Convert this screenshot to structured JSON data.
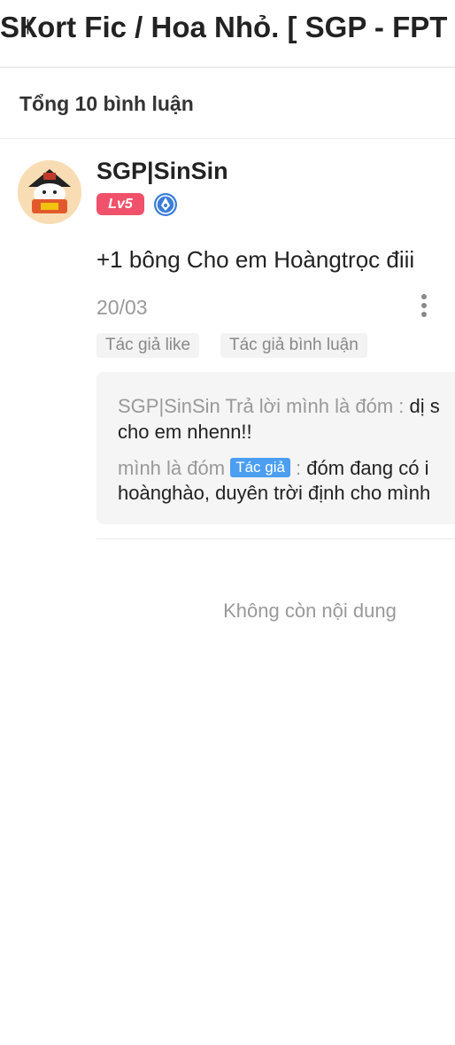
{
  "header": {
    "title": "SҜort Fic / Hoa Nhỏ. [ SGP - FPT"
  },
  "comments_header": {
    "count_label": "Tổng 10 bình luận"
  },
  "comment": {
    "username": "SGP|SinSin",
    "level": "Lv5",
    "text": "+1 bông Cho em Hoàngtrọc điii",
    "date": "20/03",
    "tags": [
      "Tác giả like",
      "Tác giả bình luận"
    ],
    "replies": [
      {
        "author": "SGP|SinSin",
        "connector": " Trả lời ",
        "target": "mình là đóm",
        "separator": " : ",
        "text_line1": "dị s",
        "text_line2": "cho em nhenn!!"
      },
      {
        "author": "mình là đóm",
        "author_tag": "Tác giả",
        "separator": " : ",
        "text_line1": "đóm đang có i",
        "text_line2": "hoànghào, duyên trời định cho mình"
      }
    ]
  },
  "footer": {
    "end_text": "Không còn nội dung"
  },
  "colors": {
    "level_badge": "#f0516b",
    "author_tag": "#4b9ef0",
    "verified": "#3b7dd8"
  },
  "icons": [
    "more-vertical-icon",
    "verified-icon"
  ]
}
